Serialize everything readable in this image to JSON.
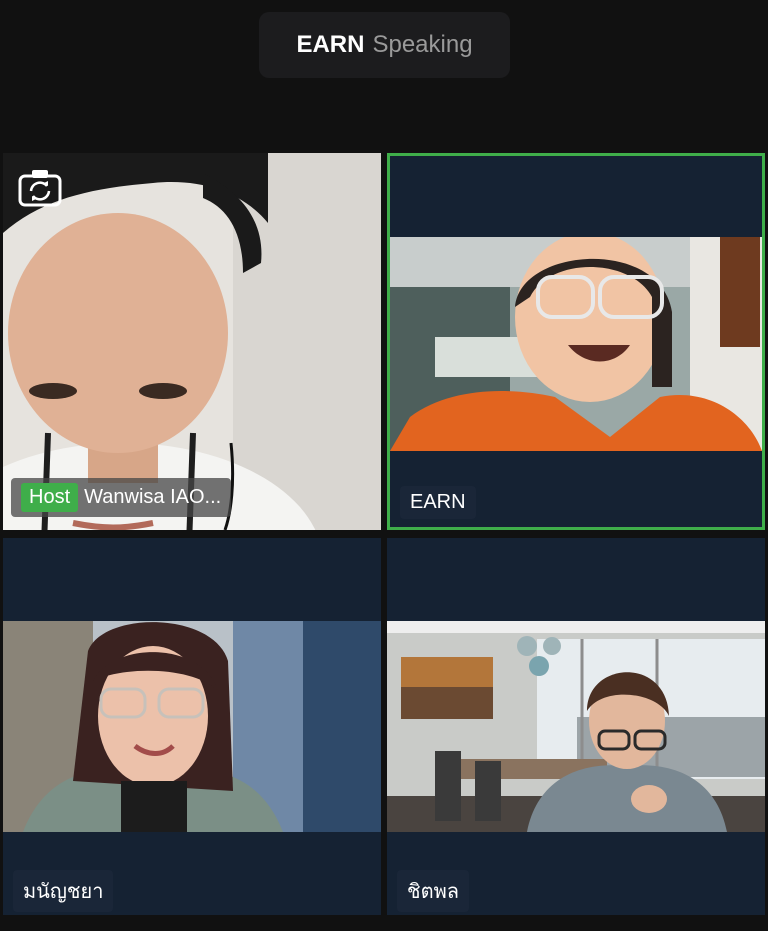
{
  "header": {
    "speaker_name": "EARN",
    "speaker_status": "Speaking"
  },
  "participants": [
    {
      "name": "Wanwisa IAO...",
      "badge": "Host",
      "active": false
    },
    {
      "name": "EARN",
      "badge": "",
      "active": true
    },
    {
      "name": "มนัญชยา",
      "badge": "",
      "active": false
    },
    {
      "name": "ชิตพล",
      "badge": "",
      "active": false
    }
  ],
  "icons": {
    "camera_switch": "camera-switch-icon"
  },
  "colors": {
    "active_border": "#3fae4a",
    "host_badge": "#3fae4a",
    "tile_background": "#152233",
    "app_background": "#111111"
  }
}
